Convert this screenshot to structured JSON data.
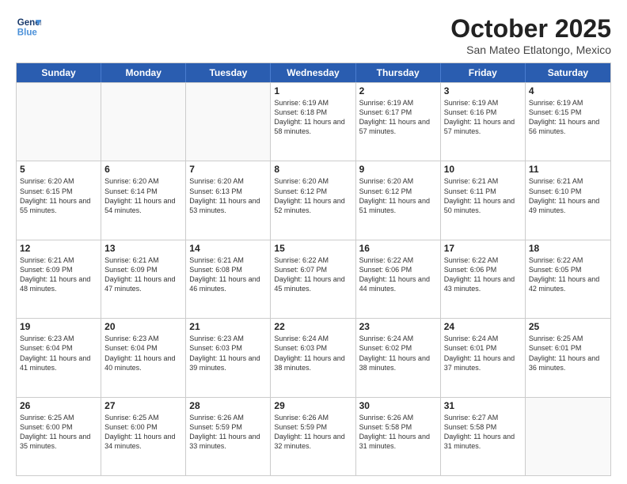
{
  "header": {
    "logo_line1": "General",
    "logo_line2": "Blue",
    "month_title": "October 2025",
    "location": "San Mateo Etlatongo, Mexico"
  },
  "weekdays": [
    "Sunday",
    "Monday",
    "Tuesday",
    "Wednesday",
    "Thursday",
    "Friday",
    "Saturday"
  ],
  "weeks": [
    [
      {
        "day": "",
        "sunrise": "",
        "sunset": "",
        "daylight": "",
        "empty": true
      },
      {
        "day": "",
        "sunrise": "",
        "sunset": "",
        "daylight": "",
        "empty": true
      },
      {
        "day": "",
        "sunrise": "",
        "sunset": "",
        "daylight": "",
        "empty": true
      },
      {
        "day": "1",
        "sunrise": "Sunrise: 6:19 AM",
        "sunset": "Sunset: 6:18 PM",
        "daylight": "Daylight: 11 hours and 58 minutes."
      },
      {
        "day": "2",
        "sunrise": "Sunrise: 6:19 AM",
        "sunset": "Sunset: 6:17 PM",
        "daylight": "Daylight: 11 hours and 57 minutes."
      },
      {
        "day": "3",
        "sunrise": "Sunrise: 6:19 AM",
        "sunset": "Sunset: 6:16 PM",
        "daylight": "Daylight: 11 hours and 57 minutes."
      },
      {
        "day": "4",
        "sunrise": "Sunrise: 6:19 AM",
        "sunset": "Sunset: 6:15 PM",
        "daylight": "Daylight: 11 hours and 56 minutes."
      }
    ],
    [
      {
        "day": "5",
        "sunrise": "Sunrise: 6:20 AM",
        "sunset": "Sunset: 6:15 PM",
        "daylight": "Daylight: 11 hours and 55 minutes."
      },
      {
        "day": "6",
        "sunrise": "Sunrise: 6:20 AM",
        "sunset": "Sunset: 6:14 PM",
        "daylight": "Daylight: 11 hours and 54 minutes."
      },
      {
        "day": "7",
        "sunrise": "Sunrise: 6:20 AM",
        "sunset": "Sunset: 6:13 PM",
        "daylight": "Daylight: 11 hours and 53 minutes."
      },
      {
        "day": "8",
        "sunrise": "Sunrise: 6:20 AM",
        "sunset": "Sunset: 6:12 PM",
        "daylight": "Daylight: 11 hours and 52 minutes."
      },
      {
        "day": "9",
        "sunrise": "Sunrise: 6:20 AM",
        "sunset": "Sunset: 6:12 PM",
        "daylight": "Daylight: 11 hours and 51 minutes."
      },
      {
        "day": "10",
        "sunrise": "Sunrise: 6:21 AM",
        "sunset": "Sunset: 6:11 PM",
        "daylight": "Daylight: 11 hours and 50 minutes."
      },
      {
        "day": "11",
        "sunrise": "Sunrise: 6:21 AM",
        "sunset": "Sunset: 6:10 PM",
        "daylight": "Daylight: 11 hours and 49 minutes."
      }
    ],
    [
      {
        "day": "12",
        "sunrise": "Sunrise: 6:21 AM",
        "sunset": "Sunset: 6:09 PM",
        "daylight": "Daylight: 11 hours and 48 minutes."
      },
      {
        "day": "13",
        "sunrise": "Sunrise: 6:21 AM",
        "sunset": "Sunset: 6:09 PM",
        "daylight": "Daylight: 11 hours and 47 minutes."
      },
      {
        "day": "14",
        "sunrise": "Sunrise: 6:21 AM",
        "sunset": "Sunset: 6:08 PM",
        "daylight": "Daylight: 11 hours and 46 minutes."
      },
      {
        "day": "15",
        "sunrise": "Sunrise: 6:22 AM",
        "sunset": "Sunset: 6:07 PM",
        "daylight": "Daylight: 11 hours and 45 minutes."
      },
      {
        "day": "16",
        "sunrise": "Sunrise: 6:22 AM",
        "sunset": "Sunset: 6:06 PM",
        "daylight": "Daylight: 11 hours and 44 minutes."
      },
      {
        "day": "17",
        "sunrise": "Sunrise: 6:22 AM",
        "sunset": "Sunset: 6:06 PM",
        "daylight": "Daylight: 11 hours and 43 minutes."
      },
      {
        "day": "18",
        "sunrise": "Sunrise: 6:22 AM",
        "sunset": "Sunset: 6:05 PM",
        "daylight": "Daylight: 11 hours and 42 minutes."
      }
    ],
    [
      {
        "day": "19",
        "sunrise": "Sunrise: 6:23 AM",
        "sunset": "Sunset: 6:04 PM",
        "daylight": "Daylight: 11 hours and 41 minutes."
      },
      {
        "day": "20",
        "sunrise": "Sunrise: 6:23 AM",
        "sunset": "Sunset: 6:04 PM",
        "daylight": "Daylight: 11 hours and 40 minutes."
      },
      {
        "day": "21",
        "sunrise": "Sunrise: 6:23 AM",
        "sunset": "Sunset: 6:03 PM",
        "daylight": "Daylight: 11 hours and 39 minutes."
      },
      {
        "day": "22",
        "sunrise": "Sunrise: 6:24 AM",
        "sunset": "Sunset: 6:03 PM",
        "daylight": "Daylight: 11 hours and 38 minutes."
      },
      {
        "day": "23",
        "sunrise": "Sunrise: 6:24 AM",
        "sunset": "Sunset: 6:02 PM",
        "daylight": "Daylight: 11 hours and 38 minutes."
      },
      {
        "day": "24",
        "sunrise": "Sunrise: 6:24 AM",
        "sunset": "Sunset: 6:01 PM",
        "daylight": "Daylight: 11 hours and 37 minutes."
      },
      {
        "day": "25",
        "sunrise": "Sunrise: 6:25 AM",
        "sunset": "Sunset: 6:01 PM",
        "daylight": "Daylight: 11 hours and 36 minutes."
      }
    ],
    [
      {
        "day": "26",
        "sunrise": "Sunrise: 6:25 AM",
        "sunset": "Sunset: 6:00 PM",
        "daylight": "Daylight: 11 hours and 35 minutes."
      },
      {
        "day": "27",
        "sunrise": "Sunrise: 6:25 AM",
        "sunset": "Sunset: 6:00 PM",
        "daylight": "Daylight: 11 hours and 34 minutes."
      },
      {
        "day": "28",
        "sunrise": "Sunrise: 6:26 AM",
        "sunset": "Sunset: 5:59 PM",
        "daylight": "Daylight: 11 hours and 33 minutes."
      },
      {
        "day": "29",
        "sunrise": "Sunrise: 6:26 AM",
        "sunset": "Sunset: 5:59 PM",
        "daylight": "Daylight: 11 hours and 32 minutes."
      },
      {
        "day": "30",
        "sunrise": "Sunrise: 6:26 AM",
        "sunset": "Sunset: 5:58 PM",
        "daylight": "Daylight: 11 hours and 31 minutes."
      },
      {
        "day": "31",
        "sunrise": "Sunrise: 6:27 AM",
        "sunset": "Sunset: 5:58 PM",
        "daylight": "Daylight: 11 hours and 31 minutes."
      },
      {
        "day": "",
        "sunrise": "",
        "sunset": "",
        "daylight": "",
        "empty": true
      }
    ]
  ]
}
